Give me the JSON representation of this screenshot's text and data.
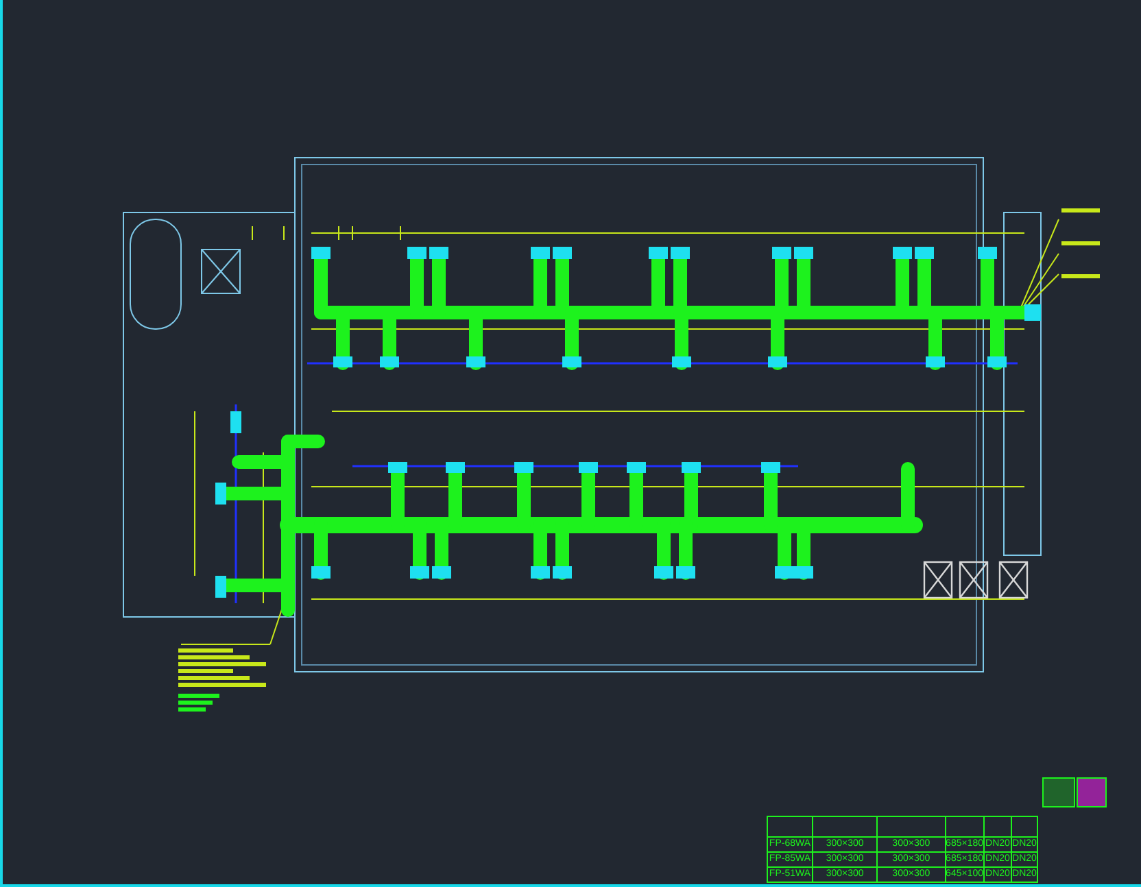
{
  "schedule_table": {
    "rows": [
      {
        "model": "FP-68WA",
        "column_2": "300×300",
        "column_3": "300×300",
        "column_4": "685×180",
        "column_5": "DN20",
        "column_6": "DN20"
      },
      {
        "model": "FP-85WA",
        "column_2": "300×300",
        "column_3": "300×300",
        "column_4": "685×180",
        "column_5": "DN20",
        "column_6": "DN20"
      },
      {
        "model": "FP-51WA",
        "column_2": "300×300",
        "column_3": "300×300",
        "column_4": "645×100",
        "column_5": "DN20",
        "column_6": "DN20"
      }
    ]
  }
}
